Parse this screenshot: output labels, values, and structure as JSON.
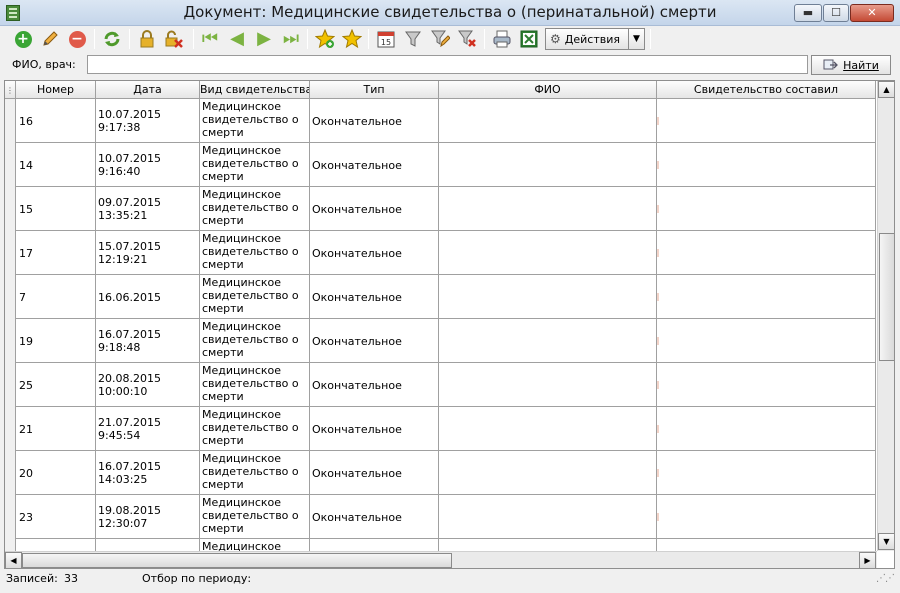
{
  "window": {
    "title": "Документ: Медицинские свидетельства о (перинатальной) смерти",
    "min_label": "▬",
    "max_label": "☐",
    "close_label": "✕"
  },
  "toolbar": {
    "actions_label": "Действия",
    "actions_icon": "⚙",
    "dropdown_icon": "▼"
  },
  "search": {
    "label": "ФИО, врач:",
    "value": "",
    "find_label": "Найти"
  },
  "grid": {
    "columns": [
      "Номер",
      "Дата",
      "Вид свидетельства",
      "Тип",
      "ФИО",
      "Свидетельство составил"
    ],
    "rows": [
      {
        "num": "16",
        "date": "10.07.2015 9:17:38",
        "kind": "Медицинское свидетельство о смерти",
        "type": "Окончательное",
        "extra": "("
      },
      {
        "num": "14",
        "date": "10.07.2015 9:16:40",
        "kind": "Медицинское свидетельство о смерти",
        "type": "Окончательное",
        "extra": "Н"
      },
      {
        "num": "15",
        "date": "09.07.2015 13:35:21",
        "kind": "Медицинское свидетельство о смерти",
        "type": "Окончательное",
        "extra": "Н"
      },
      {
        "num": "17",
        "date": "15.07.2015 12:19:21",
        "kind": "Медицинское свидетельство о смерти",
        "type": "Окончательное",
        "extra": "Н"
      },
      {
        "num": "7",
        "date": "16.06.2015",
        "kind": "Медицинское свидетельство о смерти",
        "type": "Окончательное",
        "extra": "("
      },
      {
        "num": "19",
        "date": "16.07.2015 9:18:48",
        "kind": "Медицинское свидетельство о смерти",
        "type": "Окончательное",
        "extra": "Н"
      },
      {
        "num": "25",
        "date": "20.08.2015 10:00:10",
        "kind": "Медицинское свидетельство о смерти",
        "type": "Окончательное",
        "extra": "("
      },
      {
        "num": "21",
        "date": "21.07.2015 9:45:54",
        "kind": "Медицинское свидетельство о смерти",
        "type": "Окончательное",
        "extra": "("
      },
      {
        "num": "20",
        "date": "16.07.2015 14:03:25",
        "kind": "Медицинское свидетельство о смерти",
        "type": "Окончательное",
        "extra": "("
      },
      {
        "num": "23",
        "date": "19.08.2015 12:30:07",
        "kind": "Медицинское свидетельство о смерти",
        "type": "Окончательное",
        "extra": "Г"
      },
      {
        "num": "",
        "date": "",
        "kind": "Медицинское",
        "type": "",
        "extra": ""
      }
    ]
  },
  "status": {
    "records_label": "Записей:",
    "records_value": "33",
    "filter_label": "Отбор по периоду:"
  },
  "colors": {
    "add": "#3aa535",
    "delete": "#e05a4a",
    "refresh": "#4f9a2c",
    "lock": "#e6b12a",
    "nav_arrow": "#7cb342",
    "star": "#f2c200"
  }
}
